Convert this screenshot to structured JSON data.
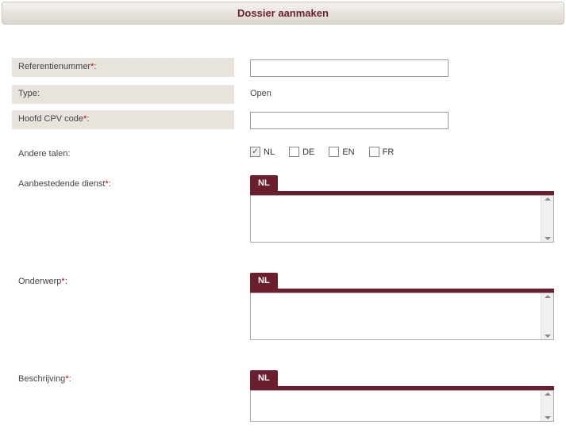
{
  "header": {
    "title": "Dossier aanmaken"
  },
  "fields": {
    "reference": {
      "label": "Referentienummer",
      "required": true,
      "value": ""
    },
    "type": {
      "label": "Type",
      "required": false,
      "value": "Open"
    },
    "cpv": {
      "label": "Hoofd CPV code",
      "required": true,
      "value": ""
    },
    "languages": {
      "label": "Andere talen",
      "required": false,
      "options": [
        {
          "code": "NL",
          "checked": true,
          "disabled": true
        },
        {
          "code": "DE",
          "checked": false,
          "disabled": false
        },
        {
          "code": "EN",
          "checked": false,
          "disabled": false
        },
        {
          "code": "FR",
          "checked": false,
          "disabled": false
        }
      ]
    },
    "authority": {
      "label": "Aanbestedende dienst",
      "required": true,
      "tab": "NL",
      "value": ""
    },
    "subject": {
      "label": "Onderwerp",
      "required": true,
      "tab": "NL",
      "value": ""
    },
    "description": {
      "label": "Beschrijving",
      "required": true,
      "tab": "NL",
      "value": ""
    }
  }
}
